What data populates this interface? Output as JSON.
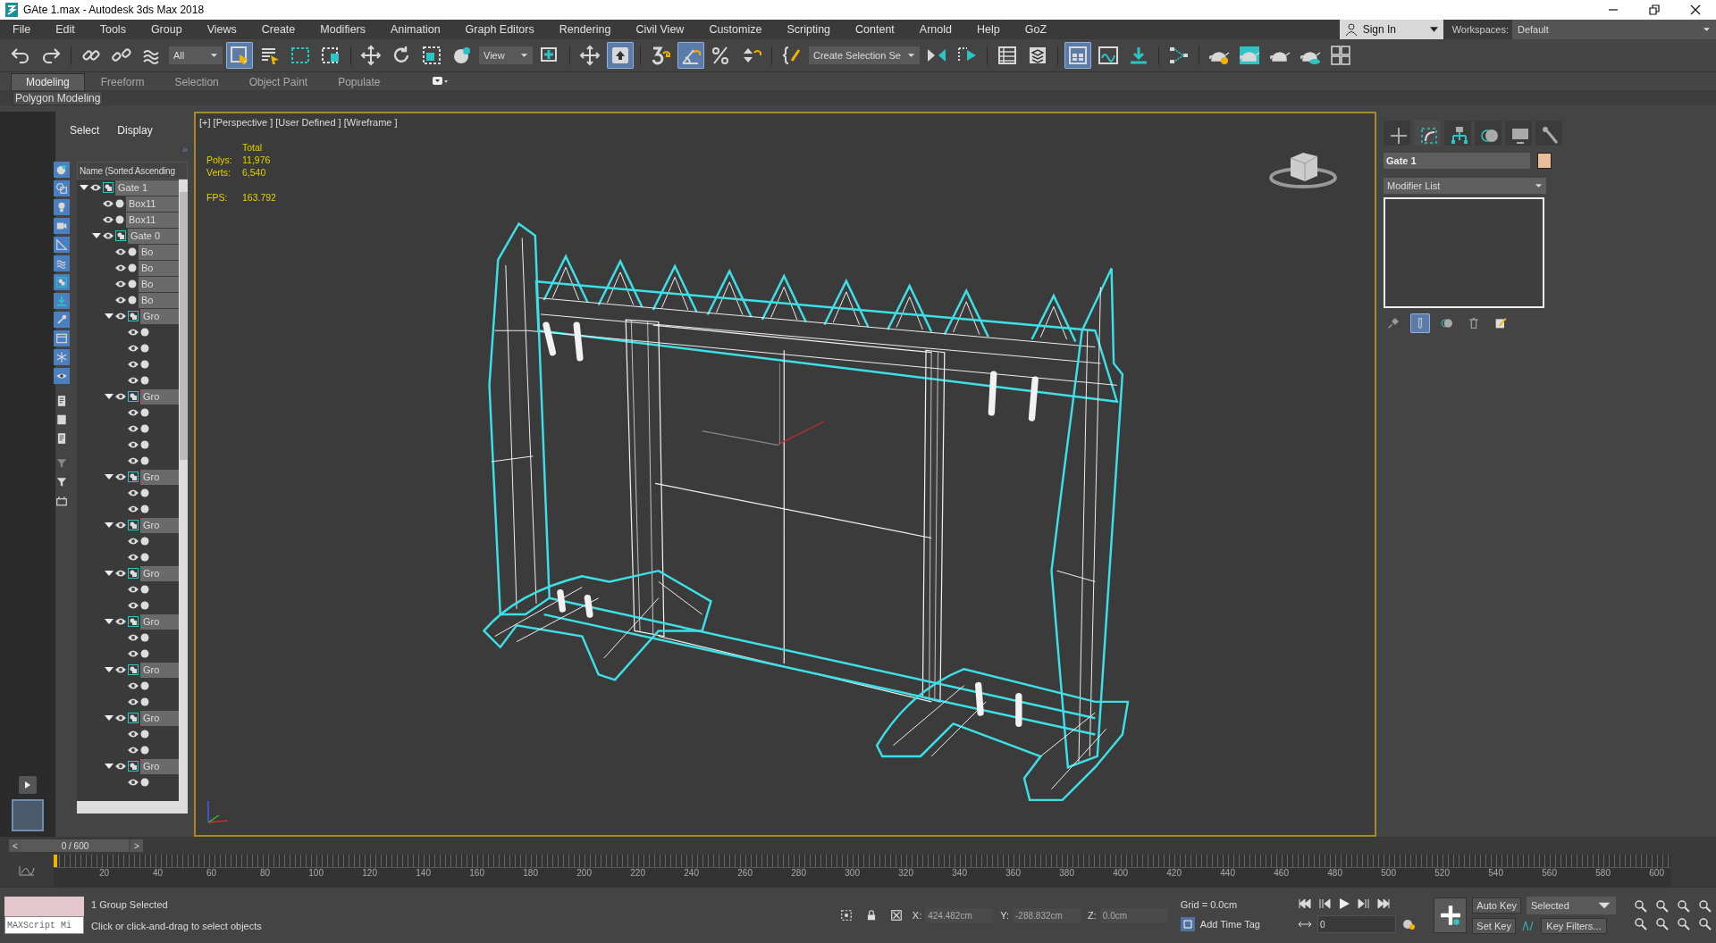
{
  "window": {
    "title": "GAte 1.max - Autodesk 3ds Max 2018",
    "controls": [
      {
        "kind": "minimize"
      },
      {
        "kind": "restore"
      },
      {
        "kind": "close"
      }
    ]
  },
  "menu": [
    "File",
    "Edit",
    "Tools",
    "Group",
    "Views",
    "Create",
    "Modifiers",
    "Animation",
    "Graph Editors",
    "Rendering",
    "Civil View",
    "Customize",
    "Scripting",
    "Content",
    "Arnold",
    "Help",
    "GoZ"
  ],
  "account": {
    "label": "Sign In"
  },
  "workspaces": {
    "label": "Workspaces:",
    "value": "Default"
  },
  "toolbar": [
    {
      "kind": "icon",
      "selected": false
    },
    {
      "kind": "icon",
      "selected": false
    },
    {
      "kind": "separator"
    },
    {
      "kind": "icon",
      "selected": false
    },
    {
      "kind": "icon",
      "selected": false
    },
    {
      "kind": "icon",
      "selected": false
    },
    {
      "kind": "dropdown",
      "value": "All"
    },
    {
      "kind": "icon",
      "selected": true
    },
    {
      "kind": "icon",
      "selected": false
    },
    {
      "kind": "icon",
      "selected": false
    },
    {
      "kind": "icon",
      "selected": false
    },
    {
      "kind": "separator"
    },
    {
      "kind": "icon",
      "selected": false
    },
    {
      "kind": "icon",
      "selected": false
    },
    {
      "kind": "icon",
      "selected": false
    },
    {
      "kind": "icon",
      "selected": false
    },
    {
      "kind": "dropdown",
      "value": "View"
    },
    {
      "kind": "icon",
      "selected": false
    },
    {
      "kind": "separator"
    },
    {
      "kind": "icon",
      "selected": false
    },
    {
      "kind": "icon",
      "selected": true
    },
    {
      "kind": "separator"
    },
    {
      "kind": "icon",
      "selected": false
    },
    {
      "kind": "icon",
      "selected": true
    },
    {
      "kind": "icon",
      "selected": false
    },
    {
      "kind": "icon",
      "selected": false
    },
    {
      "kind": "separator"
    },
    {
      "kind": "icon",
      "selected": false
    },
    {
      "kind": "dropdown",
      "value": "Create Selection Se"
    },
    {
      "kind": "icon",
      "selected": false
    },
    {
      "kind": "icon",
      "selected": false
    },
    {
      "kind": "separator"
    },
    {
      "kind": "icon",
      "selected": false
    },
    {
      "kind": "icon",
      "selected": false
    },
    {
      "kind": "separator"
    },
    {
      "kind": "icon",
      "selected": true
    },
    {
      "kind": "icon",
      "selected": false
    },
    {
      "kind": "icon",
      "selected": false
    },
    {
      "kind": "separator"
    },
    {
      "kind": "icon",
      "selected": false
    },
    {
      "kind": "separator"
    },
    {
      "kind": "icon",
      "selected": false
    },
    {
      "kind": "icon",
      "selected": false
    },
    {
      "kind": "icon",
      "selected": false
    },
    {
      "kind": "icon",
      "selected": false
    },
    {
      "kind": "icon",
      "selected": false
    }
  ],
  "ribbon": {
    "tabs": [
      {
        "label": "Modeling",
        "selected": true
      },
      {
        "label": "Freeform",
        "selected": false
      },
      {
        "label": "Selection",
        "selected": false
      },
      {
        "label": "Object Paint",
        "selected": false
      },
      {
        "label": "Populate",
        "selected": false
      }
    ],
    "panel": "Polygon Modeling"
  },
  "explorer": {
    "tabs": [
      {
        "label": "Select"
      },
      {
        "label": "Display"
      }
    ],
    "more": "»",
    "header": "Name (Sorted Ascending",
    "filters": [
      {
        "selected": true
      },
      {
        "selected": true
      },
      {
        "selected": true
      },
      {
        "selected": true
      },
      {
        "selected": true
      },
      {
        "selected": true
      },
      {
        "selected": true
      },
      {
        "selected": true
      },
      {
        "selected": true
      },
      {
        "selected": true
      },
      {
        "selected": true
      },
      {
        "selected": true
      },
      {
        "selected": false
      },
      {
        "selected": false
      },
      {
        "selected": false
      },
      {
        "selected": false
      },
      {
        "selected": false
      },
      {
        "selected": false
      }
    ],
    "tree": [
      {
        "name": "Gate 1",
        "kind": "group",
        "expanded": true,
        "children": [
          {
            "name": "Box11",
            "kind": "object"
          },
          {
            "name": "Box11",
            "kind": "object"
          },
          {
            "name": "Gate 0",
            "kind": "group",
            "expanded": true,
            "children": [
              {
                "name": "Bo",
                "kind": "object"
              },
              {
                "name": "Bo",
                "kind": "object"
              },
              {
                "name": "Bo",
                "kind": "object"
              },
              {
                "name": "Bo",
                "kind": "object"
              },
              {
                "name": "Gro",
                "kind": "group",
                "expanded": true,
                "children": [
                  {
                    "kind": "object"
                  },
                  {
                    "kind": "object"
                  },
                  {
                    "kind": "object"
                  },
                  {
                    "kind": "object"
                  }
                ]
              },
              {
                "name": "Gro",
                "kind": "group",
                "expanded": true,
                "children": [
                  {
                    "kind": "object"
                  },
                  {
                    "kind": "object"
                  },
                  {
                    "kind": "object"
                  },
                  {
                    "kind": "object"
                  }
                ]
              },
              {
                "name": "Gro",
                "kind": "group",
                "expanded": true,
                "children": [
                  {
                    "kind": "object"
                  },
                  {
                    "kind": "object"
                  }
                ]
              },
              {
                "name": "Gro",
                "kind": "group",
                "expanded": true,
                "children": [
                  {
                    "kind": "object"
                  },
                  {
                    "kind": "object"
                  }
                ]
              },
              {
                "name": "Gro",
                "kind": "group",
                "expanded": true,
                "children": [
                  {
                    "kind": "object"
                  },
                  {
                    "kind": "object"
                  }
                ]
              },
              {
                "name": "Gro",
                "kind": "group",
                "expanded": true,
                "children": [
                  {
                    "kind": "object"
                  },
                  {
                    "kind": "object"
                  }
                ]
              },
              {
                "name": "Gro",
                "kind": "group",
                "expanded": true,
                "children": [
                  {
                    "kind": "object"
                  },
                  {
                    "kind": "object"
                  }
                ]
              },
              {
                "name": "Gro",
                "kind": "group",
                "expanded": true,
                "children": [
                  {
                    "kind": "object"
                  },
                  {
                    "kind": "object"
                  }
                ]
              },
              {
                "name": "Gro",
                "kind": "group",
                "expanded": true,
                "children": [
                  {
                    "kind": "object"
                  }
                ]
              }
            ]
          }
        ]
      }
    ]
  },
  "viewport": {
    "label": "[+] [Perspective ] [User Defined ] [Wireframe ]",
    "stats_heading": "Total",
    "stats": [
      {
        "label": "Polys:",
        "value": "11,976"
      },
      {
        "label": "Verts:",
        "value": "6,540"
      }
    ],
    "fps": {
      "label": "FPS:",
      "value": "163.792"
    }
  },
  "command_panel": {
    "tabs": [
      {
        "selected": false
      },
      {
        "selected": true
      },
      {
        "selected": false
      },
      {
        "selected": false
      },
      {
        "selected": false
      },
      {
        "selected": false
      }
    ],
    "object": {
      "name": "Gate 1",
      "color": "#ecbf9c"
    },
    "modifier_list": "Modifier List",
    "stack_tools": [
      {
        "selected": false
      },
      {
        "selected": true
      },
      {
        "selected": false
      },
      {
        "selected": false
      },
      {
        "selected": false
      }
    ]
  },
  "time_slider": {
    "prev": "<",
    "next": ">",
    "reading": "0 / 600",
    "level": 0
  },
  "trackbar": {
    "ticks": [
      "20",
      "40",
      "60",
      "80",
      "100",
      "120",
      "140",
      "160",
      "180",
      "200",
      "220",
      "240",
      "260",
      "280",
      "300",
      "320",
      "340",
      "360",
      "380",
      "400",
      "420",
      "440",
      "460",
      "480",
      "500",
      "520",
      "540",
      "560",
      "580",
      "600"
    ]
  },
  "status": {
    "listener": "MAXScript Mi",
    "selection": "1 Group Selected",
    "prompt": "Click or click-and-drag to select objects",
    "coords": [
      {
        "label": "X:",
        "value": "424.482cm"
      },
      {
        "label": "Y:",
        "value": "-288.832cm"
      },
      {
        "label": "Z:",
        "value": "0.0cm"
      }
    ],
    "grid": "Grid = 0.0cm",
    "time_tag": "Add Time Tag",
    "frame": "0",
    "auto_key": "Auto Key",
    "set_key": "Set Key",
    "key_mode": "Selected",
    "key_filters": "Key Filters..."
  }
}
